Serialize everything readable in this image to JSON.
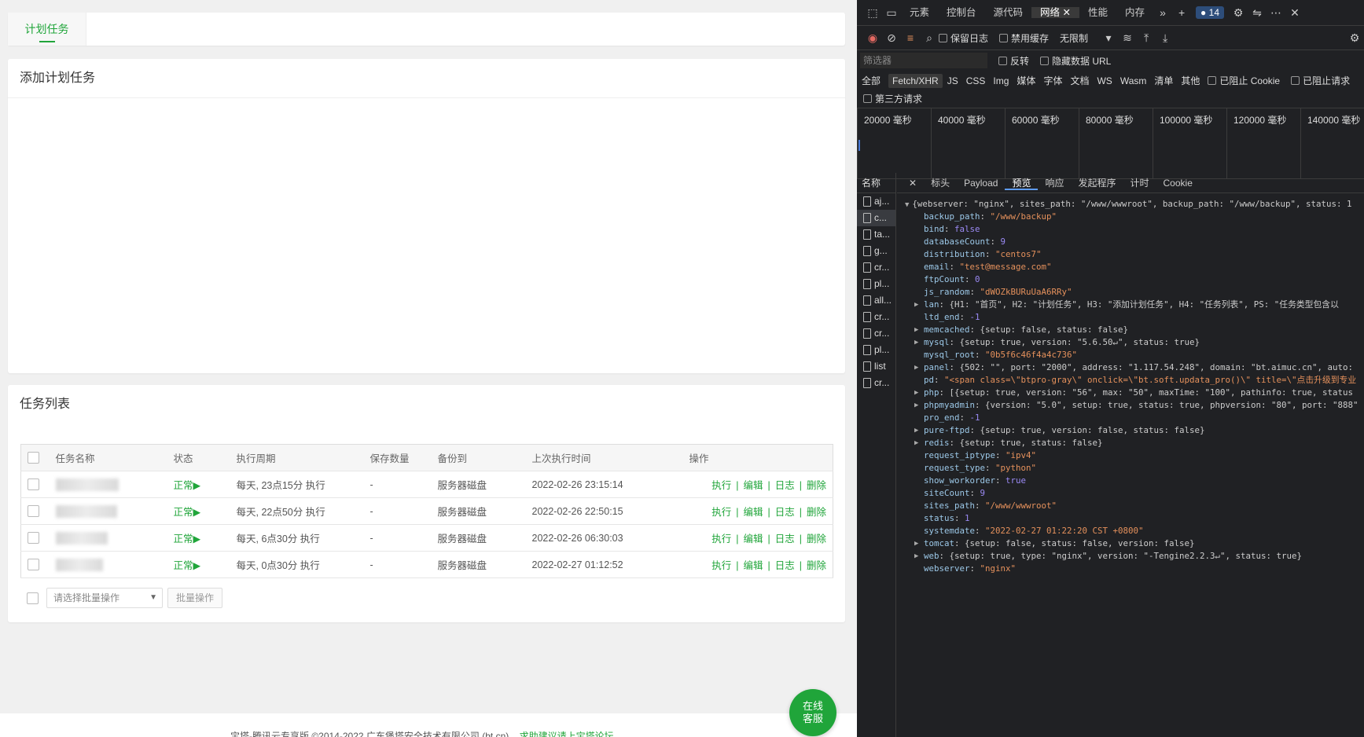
{
  "left": {
    "tab_label": "计划任务",
    "add_title": "添加计划任务",
    "list_title": "任务列表",
    "columns": [
      "任务名称",
      "状态",
      "执行周期",
      "保存数量",
      "备份到",
      "上次执行时间",
      "操作"
    ],
    "rows": [
      {
        "status": "正常▶",
        "period": "每天, 23点15分 执行",
        "count": "-",
        "backup": "服务器磁盘",
        "last": "2022-02-26 23:15:14"
      },
      {
        "status": "正常▶",
        "period": "每天, 22点50分 执行",
        "count": "-",
        "backup": "服务器磁盘",
        "last": "2022-02-26 22:50:15"
      },
      {
        "status": "正常▶",
        "period": "每天, 6点30分 执行",
        "count": "-",
        "backup": "服务器磁盘",
        "last": "2022-02-26 06:30:03"
      },
      {
        "status": "正常▶",
        "period": "每天, 0点30分 执行",
        "count": "-",
        "backup": "服务器磁盘",
        "last": "2022-02-27 01:12:52"
      }
    ],
    "ops": [
      "执行",
      "编辑",
      "日志",
      "删除"
    ],
    "batch_select": "请选择批量操作",
    "batch_button": "批量操作",
    "footer_text": "宝塔-腾讯云专享版 ©2014-2022 广东堡塔安全技术有限公司 (bt.cn)",
    "footer_link": "求助建议请上宝塔论坛",
    "service_line1": "在线",
    "service_line2": "客服",
    "accent_color": "#20a53a"
  },
  "devtools": {
    "tabs": [
      "元素",
      "控制台",
      "源代码",
      "网络",
      "性能",
      "内存"
    ],
    "active_tab": "网络",
    "badge_count": "14",
    "toolbar": {
      "preserve_log": "保留日志",
      "disable_cache": "禁用缓存",
      "throttle": "无限制"
    },
    "filter_placeholder": "筛选器",
    "invert": "反转",
    "hide_data_url": "隐藏数据 URL",
    "types": [
      "全部",
      "Fetch/XHR",
      "JS",
      "CSS",
      "Img",
      "媒体",
      "字体",
      "文档",
      "WS",
      "Wasm",
      "清单",
      "其他"
    ],
    "blocked_cookie": "已阻止 Cookie",
    "blocked_requests": "已阻止请求",
    "third_party": "第三方请求",
    "ticks": [
      "20000 毫秒",
      "40000 毫秒",
      "60000 毫秒",
      "80000 毫秒",
      "100000 毫秒",
      "120000 毫秒",
      "140000 毫秒"
    ],
    "name_header": "名称",
    "requests": [
      "aj...",
      "c...",
      "ta...",
      "g...",
      "cr...",
      "pl...",
      "all...",
      "cr...",
      "cr...",
      "pl...",
      "list",
      "cr..."
    ],
    "detail_tabs": [
      "标头",
      "Payload",
      "预览",
      "响应",
      "发起程序",
      "计时",
      "Cookie"
    ],
    "active_detail_tab": "预览",
    "json_summary": "{webserver: \"nginx\", sites_path: \"/www/wwwroot\", backup_path: \"/www/backup\", status: 1",
    "json_lines": [
      {
        "key": "backup_path",
        "val": "\"/www/backup\"",
        "t": "s"
      },
      {
        "key": "bind",
        "val": "false",
        "t": "b"
      },
      {
        "key": "databaseCount",
        "val": "9",
        "t": "n"
      },
      {
        "key": "distribution",
        "val": "\"centos7\"",
        "t": "s"
      },
      {
        "key": "email",
        "val": "\"test@message.com\"",
        "t": "s"
      },
      {
        "key": "ftpCount",
        "val": "0",
        "t": "n"
      },
      {
        "key": "js_random",
        "val": "\"dWOZkBURuUaA6RRy\"",
        "t": "s"
      },
      {
        "key": "lan",
        "val": "{H1: \"首页\", H2: \"计划任务\", H3: \"添加计划任务\", H4: \"任务列表\", PS: \"任务类型包含以",
        "t": "o",
        "exp": true
      },
      {
        "key": "ltd_end",
        "val": "-1",
        "t": "n"
      },
      {
        "key": "memcached",
        "val": "{setup: false, status: false}",
        "t": "o",
        "exp": true
      },
      {
        "key": "mysql",
        "val": "{setup: true, version: \"5.6.50↵\", status: true}",
        "t": "o",
        "exp": true
      },
      {
        "key": "mysql_root",
        "val": "\"0b5f6c46f4a4c736\"",
        "t": "s"
      },
      {
        "key": "panel",
        "val": "{502: \"\", port: \"2000\", address: \"1.117.54.248\", domain: \"bt.aimuc.cn\", auto:",
        "t": "o",
        "exp": true
      },
      {
        "key": "pd",
        "val": "\"<span class=\\\"btpro-gray\\\" onclick=\\\"bt.soft.updata_pro()\\\" title=\\\"点击升级到专业",
        "t": "s"
      },
      {
        "key": "php",
        "val": "[{setup: true, version: \"56\", max: \"50\", maxTime: \"100\", pathinfo: true, status",
        "t": "o",
        "exp": true
      },
      {
        "key": "phpmyadmin",
        "val": "{version: \"5.0\", setup: true, status: true, phpversion: \"80\", port: \"888\"",
        "t": "o",
        "exp": true
      },
      {
        "key": "pro_end",
        "val": "-1",
        "t": "n"
      },
      {
        "key": "pure-ftpd",
        "val": "{setup: true, version: false, status: false}",
        "t": "o",
        "exp": true
      },
      {
        "key": "redis",
        "val": "{setup: true, status: false}",
        "t": "o",
        "exp": true
      },
      {
        "key": "request_iptype",
        "val": "\"ipv4\"",
        "t": "s"
      },
      {
        "key": "request_type",
        "val": "\"python\"",
        "t": "s"
      },
      {
        "key": "show_workorder",
        "val": "true",
        "t": "b"
      },
      {
        "key": "siteCount",
        "val": "9",
        "t": "n"
      },
      {
        "key": "sites_path",
        "val": "\"/www/wwwroot\"",
        "t": "s"
      },
      {
        "key": "status",
        "val": "1",
        "t": "n"
      },
      {
        "key": "systemdate",
        "val": "\"2022-02-27 01:22:20 CST +0800\"",
        "t": "s"
      },
      {
        "key": "tomcat",
        "val": "{setup: false, status: false, version: false}",
        "t": "o",
        "exp": true
      },
      {
        "key": "web",
        "val": "{setup: true, type: \"nginx\", version: \"-Tengine2.2.3↵\", status: true}",
        "t": "o",
        "exp": true
      },
      {
        "key": "webserver",
        "val": "\"nginx\"",
        "t": "s"
      }
    ]
  }
}
